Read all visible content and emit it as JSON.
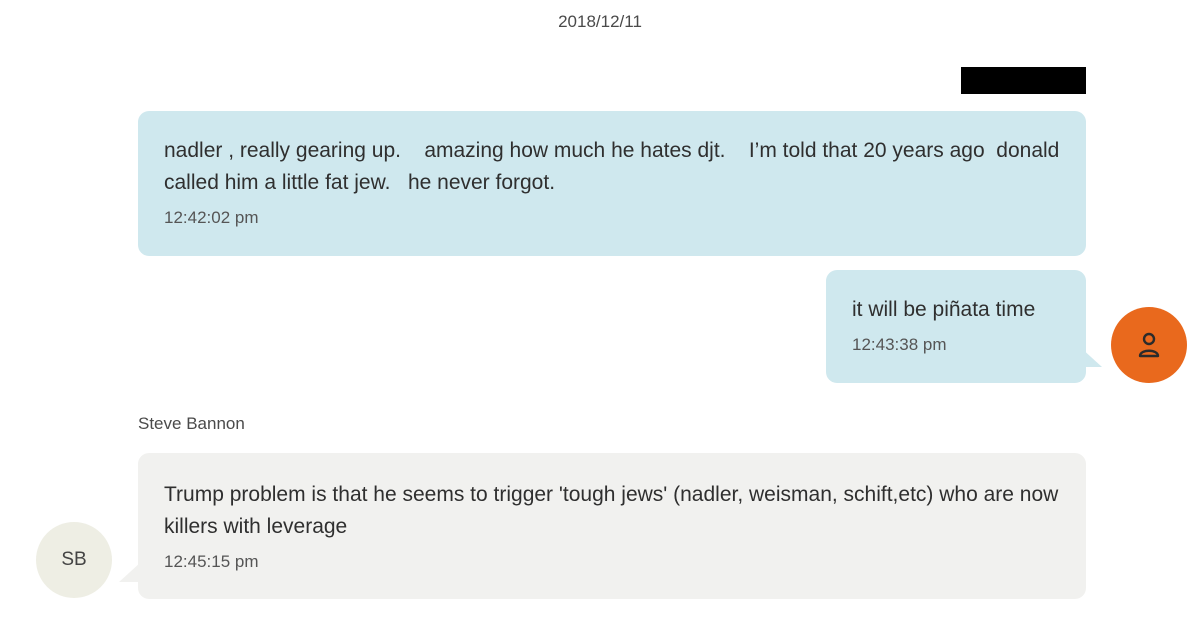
{
  "date_header": "2018/12/11",
  "messages": [
    {
      "text": "nadler , really gearing up.    amazing how much he hates djt.    I’m told that 20 years ago  donald called him a little fat jew.   he never forgot.",
      "time": "12:42:02 pm"
    },
    {
      "text": "it will be piñata time",
      "time": "12:43:38 pm",
      "avatar_icon": "person-icon"
    },
    {
      "sender": "Steve Bannon",
      "text": "Trump problem is that he seems to trigger 'tough jews' (nadler, weisman, schift,etc) who are now killers with leverage",
      "time": "12:45:15 pm",
      "avatar_initials": "SB"
    }
  ],
  "colors": {
    "outgoing_bubble": "#cfe8ee",
    "incoming_bubble": "#f1f1ef",
    "my_avatar": "#e9691d",
    "other_avatar": "#eeeee4",
    "redaction": "#000000"
  }
}
